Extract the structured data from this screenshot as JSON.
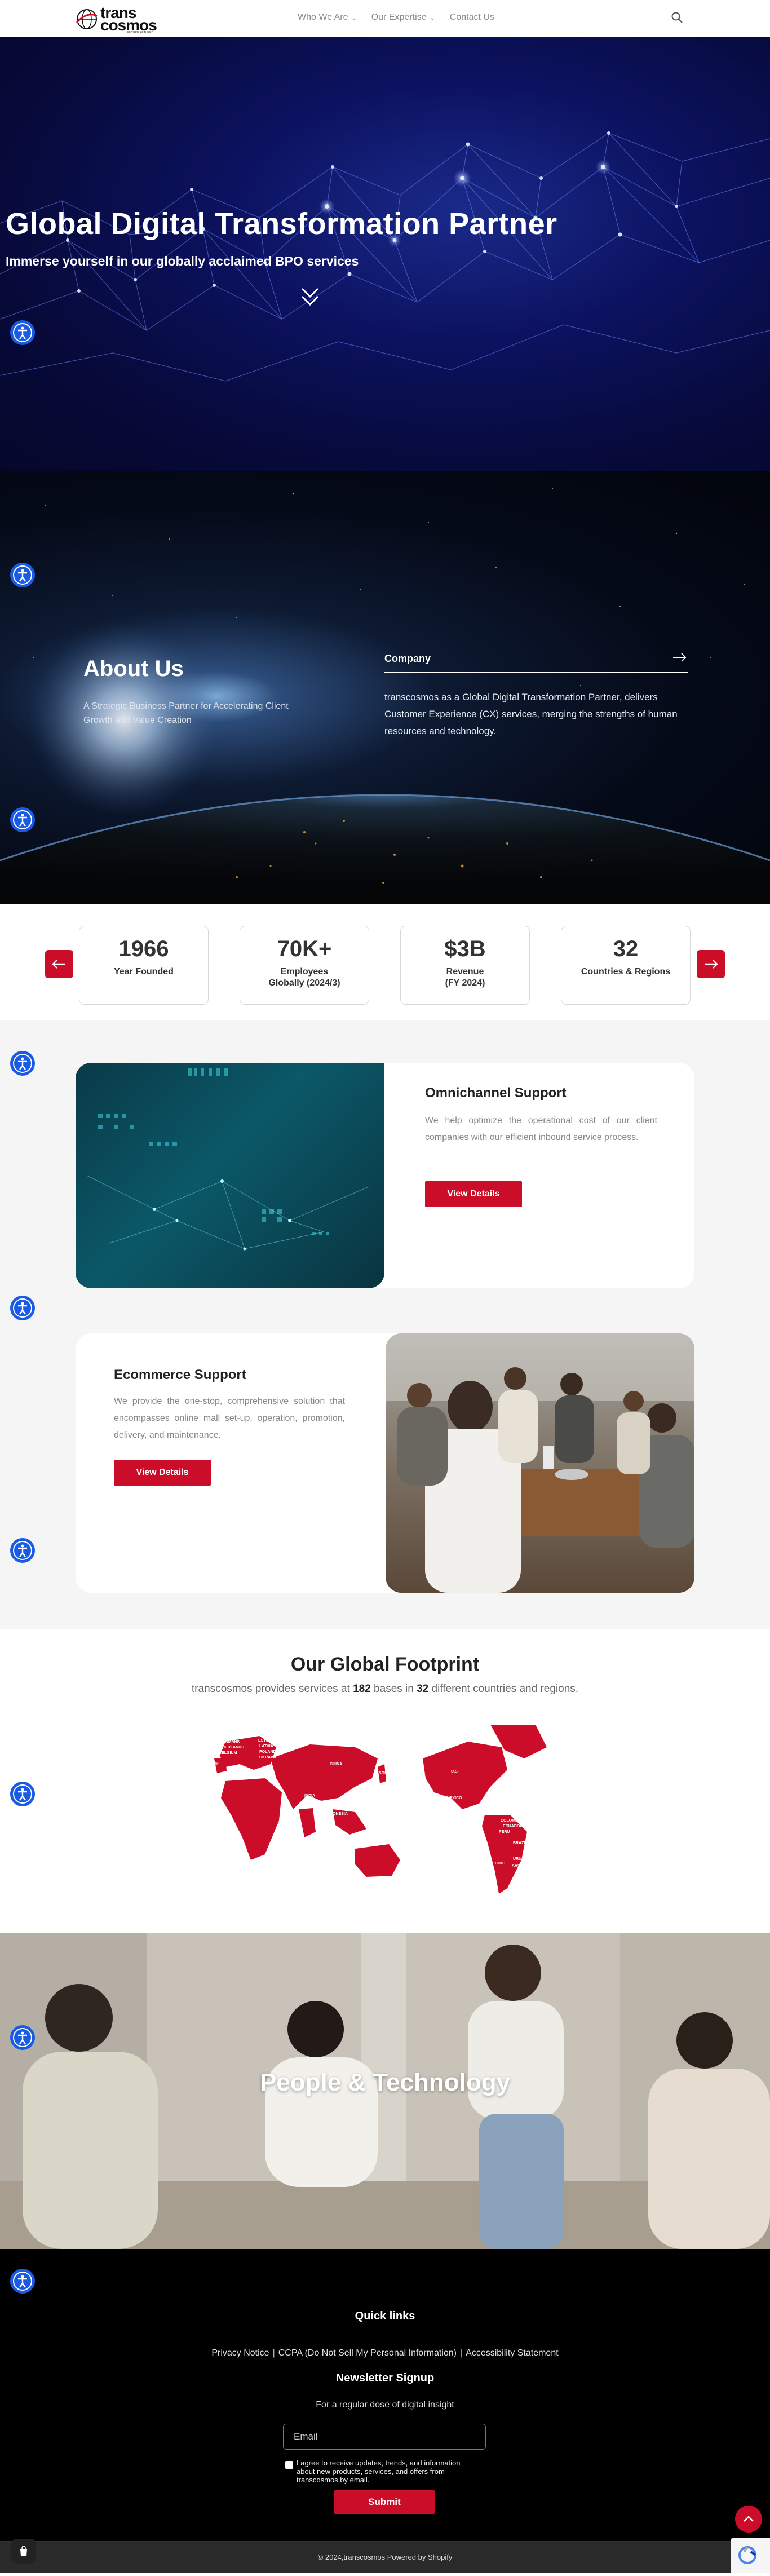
{
  "header": {
    "logo": {
      "line1": "trans",
      "line2": "cosmos",
      "tagline": "FUTURE REALIZED"
    },
    "nav": [
      {
        "label": "Who We Are",
        "has_dropdown": true
      },
      {
        "label": "Our Expertise",
        "has_dropdown": true
      },
      {
        "label": "Contact Us",
        "has_dropdown": false
      }
    ],
    "search_icon": "search-icon"
  },
  "hero": {
    "title": "Global Digital Transformation Partner",
    "subtitle": "Immerse yourself in our globally acclaimed BPO services",
    "down_icon": "double-chevron-down-icon"
  },
  "accessibility_icon": "accessibility-icon",
  "about": {
    "title": "About Us",
    "subtitle": "A Strategic Business Partner for Accelerating Client Growth and Value Creation",
    "company_label": "Company",
    "company_text": "transcosmos as a Global Digital Transformation Partner, delivers Customer Experience (CX) services, merging the strengths of human resources and technology."
  },
  "stats": [
    {
      "value": "1966",
      "label": "Year Founded"
    },
    {
      "value": "70K+",
      "label": "Employees Globally (2024/3)"
    },
    {
      "value": "$3B",
      "label": "Revenue (FY 2024)"
    },
    {
      "value": "32",
      "label": "Countries & Regions"
    }
  ],
  "services": [
    {
      "title": "Omnichannel Support",
      "text": "We help optimize the operational cost of our client companies with our efficient inbound service process.",
      "button": "View Details"
    },
    {
      "title": "Ecommerce Support",
      "text": "We provide the one-stop, comprehensive solution that encompasses online mall set-up, operation, promotion, delivery, and maintenance.",
      "button": "View Details"
    }
  ],
  "footprint": {
    "title": "Our Global Footprint",
    "desc_pre": "transcosmos provides services at ",
    "bases": "182",
    "desc_mid": " bases in ",
    "countries": "32",
    "desc_post": " different countries and regions.",
    "map_labels": [
      "NORWAY",
      "SWEDEN",
      "DENMARK",
      "NETHERLANDS",
      "BELGIUM",
      "ESTONIA",
      "LATVIA",
      "POLAND",
      "UKRAINE",
      "UK",
      "SPAIN",
      "CHINA",
      "SOUTH KOREA",
      "JAPAN",
      "TAIWAN",
      "PHILIPPINES",
      "VIETNAM",
      "THAILAND",
      "INDIA",
      "MALAYSIA",
      "SINGAPORE",
      "INDONESIA",
      "SOUTH AFRICA",
      "U.S.",
      "MEXICO",
      "COLOMBIA",
      "ECUADOR",
      "PERU",
      "BRAZIL",
      "CHILE",
      "URUGUAY",
      "ARGENTINA"
    ],
    "map_color": "#cc0d2a"
  },
  "people": {
    "title": "People & Technology"
  },
  "footer": {
    "quick_links": "Quick links",
    "links": [
      "Privacy Notice",
      "CCPA (Do Not Sell My Personal Information)",
      "Accessibility Statement"
    ],
    "newsletter_title": "Newsletter Signup",
    "newsletter_sub": "For a regular dose of digital insight",
    "email_placeholder": "Email",
    "consent": "I agree to receive updates, trends, and information about new products, services, and offers from transcosmos by email.",
    "submit": "Submit",
    "copyright": "© 2024,transcosmos Powered by Shopify"
  },
  "colors": {
    "brand_red": "#cc0d2a",
    "accessibility_blue": "#1a5be6"
  }
}
